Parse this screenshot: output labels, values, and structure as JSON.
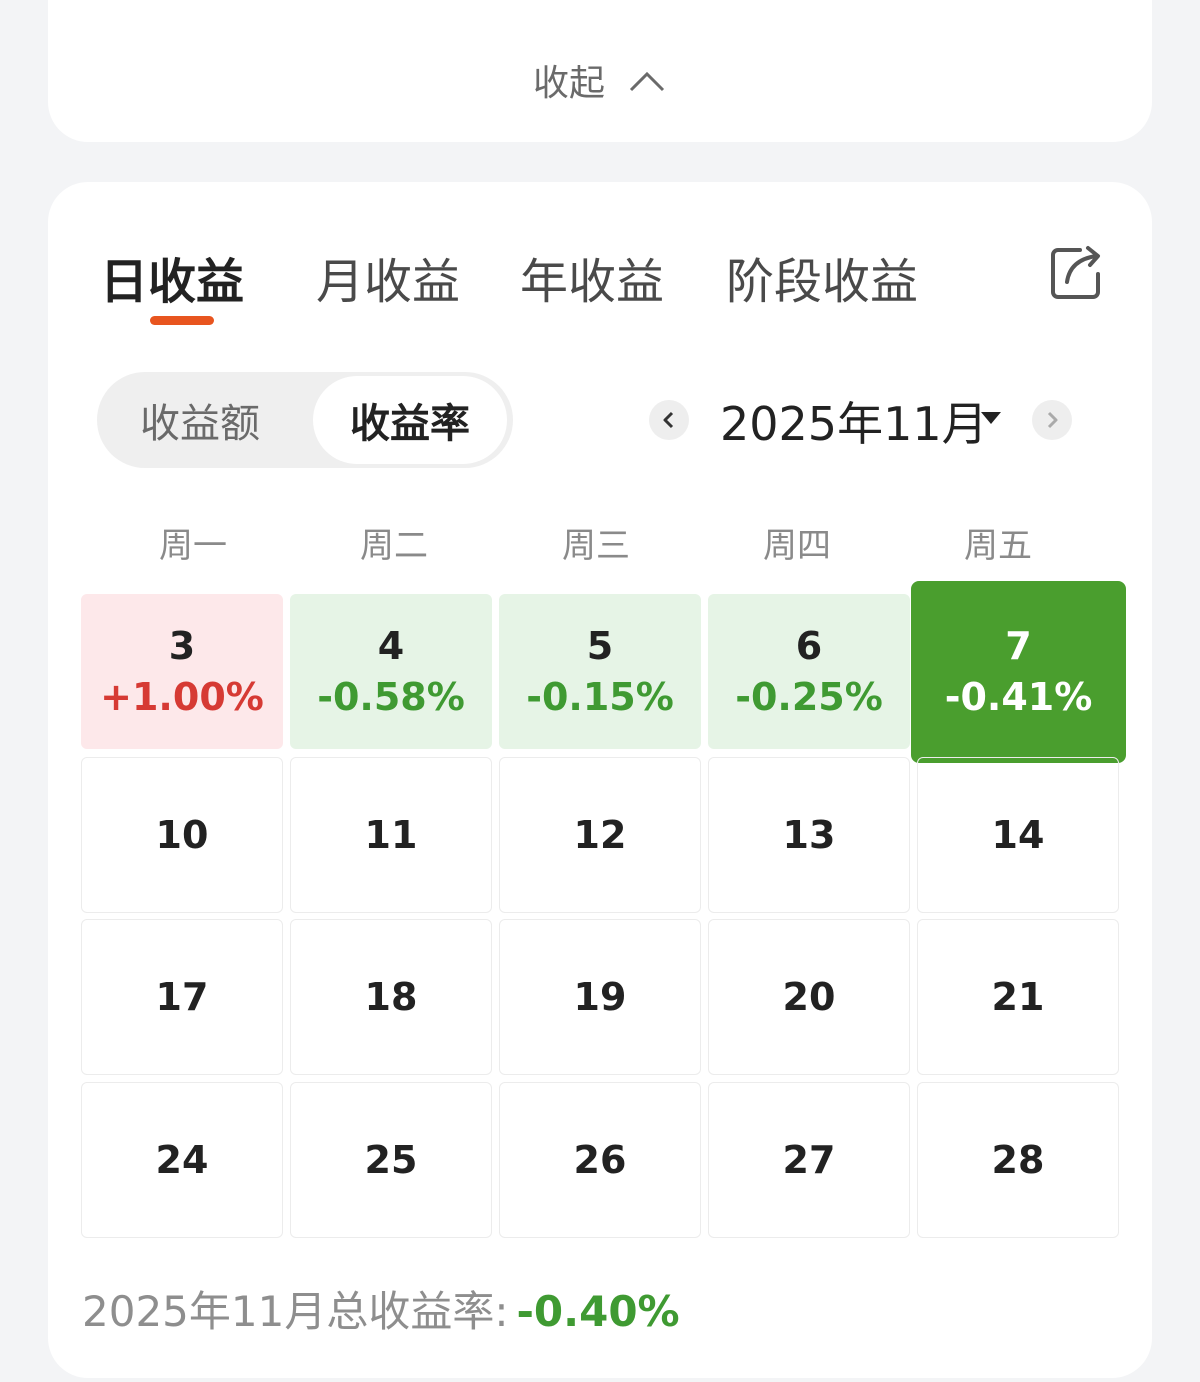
{
  "collapse": {
    "label": "收起"
  },
  "tabs": [
    {
      "label": "日收益",
      "active": true
    },
    {
      "label": "月收益",
      "active": false
    },
    {
      "label": "年收益",
      "active": false
    },
    {
      "label": "阶段收益",
      "active": false
    }
  ],
  "segmented": {
    "amount": "收益额",
    "rate": "收益率",
    "selected": "rate"
  },
  "month": {
    "label": "2025年11月"
  },
  "weekdays": [
    "周一",
    "周二",
    "周三",
    "周四",
    "周五"
  ],
  "calendar": {
    "rows": [
      [
        {
          "day": "3",
          "rate": "+1.00%",
          "tone": "up"
        },
        {
          "day": "4",
          "rate": "-0.58%",
          "tone": "down"
        },
        {
          "day": "5",
          "rate": "-0.15%",
          "tone": "down"
        },
        {
          "day": "6",
          "rate": "-0.25%",
          "tone": "down"
        },
        {
          "day": "7",
          "rate": "-0.41%",
          "tone": "selected"
        }
      ],
      [
        {
          "day": "10"
        },
        {
          "day": "11"
        },
        {
          "day": "12"
        },
        {
          "day": "13"
        },
        {
          "day": "14"
        }
      ],
      [
        {
          "day": "17"
        },
        {
          "day": "18"
        },
        {
          "day": "19"
        },
        {
          "day": "20"
        },
        {
          "day": "21"
        }
      ],
      [
        {
          "day": "24"
        },
        {
          "day": "25"
        },
        {
          "day": "26"
        },
        {
          "day": "27"
        },
        {
          "day": "28"
        }
      ]
    ]
  },
  "total": {
    "label": "2025年11月总收益率:",
    "value": "-0.40%"
  },
  "colors": {
    "accent": "#e8551f",
    "gain": "#d63a34",
    "loss": "#3f9a32",
    "selected": "#4a9e2e"
  },
  "icons": {
    "collapse": "chevron-up-icon",
    "share": "share-icon",
    "prev": "chevron-left-icon",
    "next": "chevron-right-icon",
    "month_dropdown": "caret-down-icon"
  }
}
